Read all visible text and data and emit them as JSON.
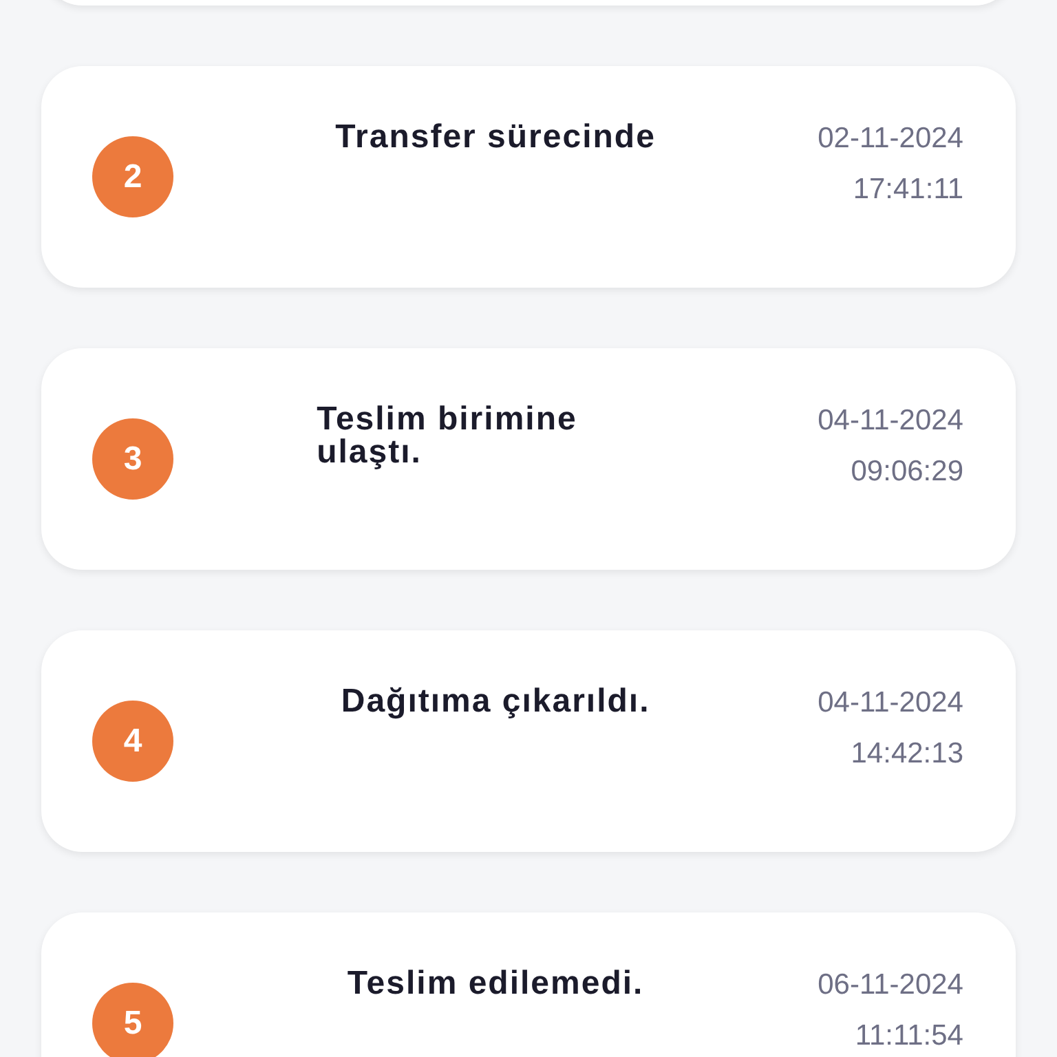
{
  "steps": [
    {
      "number": "2",
      "title": "Transfer sürecinde",
      "date": "02-11-2024",
      "time": "17:41:11"
    },
    {
      "number": "3",
      "title": "Teslim birimine ulaştı.",
      "date": "04-11-2024",
      "time": "09:06:29"
    },
    {
      "number": "4",
      "title": "Dağıtıma çıkarıldı.",
      "date": "04-11-2024",
      "time": "14:42:13"
    },
    {
      "number": "5",
      "title": "Teslim edilemedi.",
      "date": "06-11-2024",
      "time": "11:11:54"
    }
  ]
}
